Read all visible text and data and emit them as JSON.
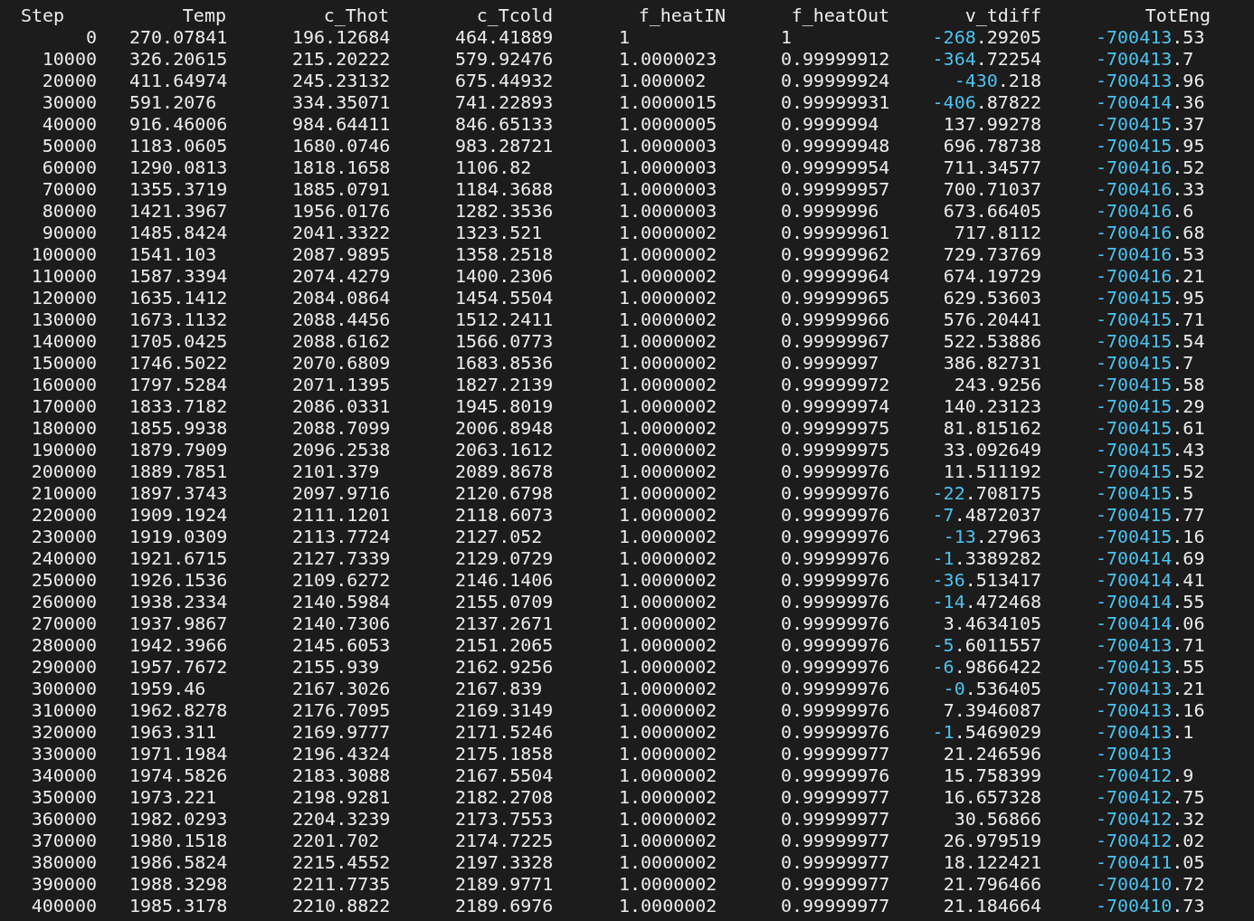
{
  "table": {
    "columns": [
      "Step",
      "Temp",
      "c_Thot",
      "c_Tcold",
      "f_heatIN",
      "f_heatOut",
      "v_tdiff",
      "TotEng"
    ],
    "rows": [
      [
        "0",
        "270.07841",
        "196.12684",
        "464.41889",
        "1",
        "1",
        "-268.29205",
        "-700413.53"
      ],
      [
        "10000",
        "326.20615",
        "215.20222",
        "579.92476",
        "1.0000023",
        "0.99999912",
        "-364.72254",
        "-700413.7"
      ],
      [
        "20000",
        "411.64974",
        "245.23132",
        "675.44932",
        "1.000002",
        "0.99999924",
        "-430.218",
        "-700413.96"
      ],
      [
        "30000",
        "591.2076",
        "334.35071",
        "741.22893",
        "1.0000015",
        "0.99999931",
        "-406.87822",
        "-700414.36"
      ],
      [
        "40000",
        "916.46006",
        "984.64411",
        "846.65133",
        "1.0000005",
        "0.9999994",
        "137.99278",
        "-700415.37"
      ],
      [
        "50000",
        "1183.0605",
        "1680.0746",
        "983.28721",
        "1.0000003",
        "0.99999948",
        "696.78738",
        "-700415.95"
      ],
      [
        "60000",
        "1290.0813",
        "1818.1658",
        "1106.82",
        "1.0000003",
        "0.99999954",
        "711.34577",
        "-700416.52"
      ],
      [
        "70000",
        "1355.3719",
        "1885.0791",
        "1184.3688",
        "1.0000003",
        "0.99999957",
        "700.71037",
        "-700416.33"
      ],
      [
        "80000",
        "1421.3967",
        "1956.0176",
        "1282.3536",
        "1.0000003",
        "0.9999996",
        "673.66405",
        "-700416.6"
      ],
      [
        "90000",
        "1485.8424",
        "2041.3322",
        "1323.521",
        "1.0000002",
        "0.99999961",
        "717.8112",
        "-700416.68"
      ],
      [
        "100000",
        "1541.103",
        "2087.9895",
        "1358.2518",
        "1.0000002",
        "0.99999962",
        "729.73769",
        "-700416.53"
      ],
      [
        "110000",
        "1587.3394",
        "2074.4279",
        "1400.2306",
        "1.0000002",
        "0.99999964",
        "674.19729",
        "-700416.21"
      ],
      [
        "120000",
        "1635.1412",
        "2084.0864",
        "1454.5504",
        "1.0000002",
        "0.99999965",
        "629.53603",
        "-700415.95"
      ],
      [
        "130000",
        "1673.1132",
        "2088.4456",
        "1512.2411",
        "1.0000002",
        "0.99999966",
        "576.20441",
        "-700415.71"
      ],
      [
        "140000",
        "1705.0425",
        "2088.6162",
        "1566.0773",
        "1.0000002",
        "0.99999967",
        "522.53886",
        "-700415.54"
      ],
      [
        "150000",
        "1746.5022",
        "2070.6809",
        "1683.8536",
        "1.0000002",
        "0.9999997",
        "386.82731",
        "-700415.7"
      ],
      [
        "160000",
        "1797.5284",
        "2071.1395",
        "1827.2139",
        "1.0000002",
        "0.99999972",
        "243.9256",
        "-700415.58"
      ],
      [
        "170000",
        "1833.7182",
        "2086.0331",
        "1945.8019",
        "1.0000002",
        "0.99999974",
        "140.23123",
        "-700415.29"
      ],
      [
        "180000",
        "1855.9938",
        "2088.7099",
        "2006.8948",
        "1.0000002",
        "0.99999975",
        "81.815162",
        "-700415.61"
      ],
      [
        "190000",
        "1879.7909",
        "2096.2538",
        "2063.1612",
        "1.0000002",
        "0.99999975",
        "33.092649",
        "-700415.43"
      ],
      [
        "200000",
        "1889.7851",
        "2101.379",
        "2089.8678",
        "1.0000002",
        "0.99999976",
        "11.511192",
        "-700415.52"
      ],
      [
        "210000",
        "1897.3743",
        "2097.9716",
        "2120.6798",
        "1.0000002",
        "0.99999976",
        "-22.708175",
        "-700415.5"
      ],
      [
        "220000",
        "1909.1924",
        "2111.1201",
        "2118.6073",
        "1.0000002",
        "0.99999976",
        "-7.4872037",
        "-700415.77"
      ],
      [
        "230000",
        "1919.0309",
        "2113.7724",
        "2127.052",
        "1.0000002",
        "0.99999976",
        "-13.27963",
        "-700415.16"
      ],
      [
        "240000",
        "1921.6715",
        "2127.7339",
        "2129.0729",
        "1.0000002",
        "0.99999976",
        "-1.3389282",
        "-700414.69"
      ],
      [
        "250000",
        "1926.1536",
        "2109.6272",
        "2146.1406",
        "1.0000002",
        "0.99999976",
        "-36.513417",
        "-700414.41"
      ],
      [
        "260000",
        "1938.2334",
        "2140.5984",
        "2155.0709",
        "1.0000002",
        "0.99999976",
        "-14.472468",
        "-700414.55"
      ],
      [
        "270000",
        "1937.9867",
        "2140.7306",
        "2137.2671",
        "1.0000002",
        "0.99999976",
        "3.4634105",
        "-700414.06"
      ],
      [
        "280000",
        "1942.3966",
        "2145.6053",
        "2151.2065",
        "1.0000002",
        "0.99999976",
        "-5.6011557",
        "-700413.71"
      ],
      [
        "290000",
        "1957.7672",
        "2155.939",
        "2162.9256",
        "1.0000002",
        "0.99999976",
        "-6.9866422",
        "-700413.55"
      ],
      [
        "300000",
        "1959.46",
        "2167.3026",
        "2167.839",
        "1.0000002",
        "0.99999976",
        "-0.536405",
        "-700413.21"
      ],
      [
        "310000",
        "1962.8278",
        "2176.7095",
        "2169.3149",
        "1.0000002",
        "0.99999976",
        "7.3946087",
        "-700413.16"
      ],
      [
        "320000",
        "1963.311",
        "2169.9777",
        "2171.5246",
        "1.0000002",
        "0.99999976",
        "-1.5469029",
        "-700413.1"
      ],
      [
        "330000",
        "1971.1984",
        "2196.4324",
        "2175.1858",
        "1.0000002",
        "0.99999977",
        "21.246596",
        "-700413"
      ],
      [
        "340000",
        "1974.5826",
        "2183.3088",
        "2167.5504",
        "1.0000002",
        "0.99999976",
        "15.758399",
        "-700412.9"
      ],
      [
        "350000",
        "1973.221",
        "2198.9281",
        "2182.2708",
        "1.0000002",
        "0.99999977",
        "16.657328",
        "-700412.75"
      ],
      [
        "360000",
        "1982.0293",
        "2204.3239",
        "2173.7553",
        "1.0000002",
        "0.99999977",
        "30.56866",
        "-700412.32"
      ],
      [
        "370000",
        "1980.1518",
        "2201.702",
        "2174.7225",
        "1.0000002",
        "0.99999977",
        "26.979519",
        "-700412.02"
      ],
      [
        "380000",
        "1986.5824",
        "2215.4552",
        "2197.3328",
        "1.0000002",
        "0.99999977",
        "18.122421",
        "-700411.05"
      ],
      [
        "390000",
        "1988.3298",
        "2211.7735",
        "2189.9771",
        "1.0000002",
        "0.99999977",
        "21.796466",
        "-700410.72"
      ],
      [
        "400000",
        "1985.3178",
        "2210.8822",
        "2189.6976",
        "1.0000002",
        "0.99999977",
        "21.184664",
        "-700410.73"
      ]
    ]
  }
}
